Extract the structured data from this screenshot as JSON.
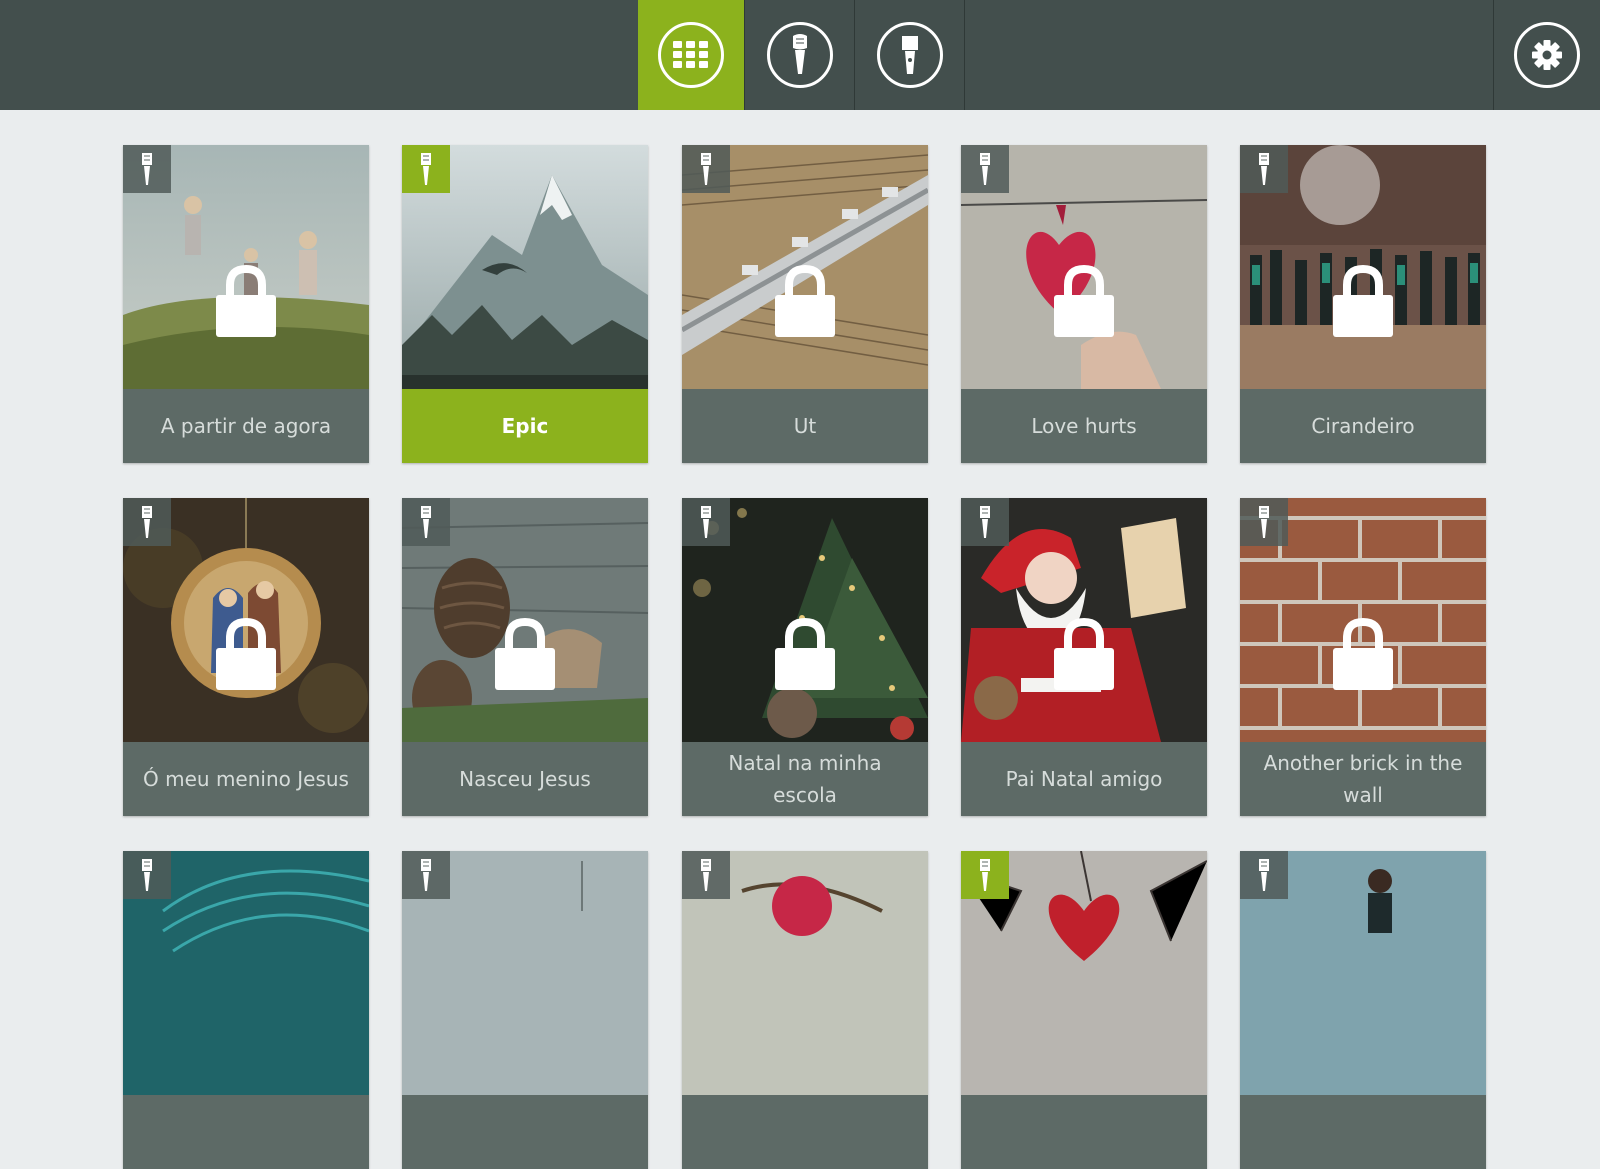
{
  "header": {
    "nav": [
      {
        "id": "grid",
        "icon": "grid-icon",
        "label": "",
        "active": true
      },
      {
        "id": "mic",
        "icon": "microphone-icon",
        "label": "",
        "active": false
      },
      {
        "id": "mic-alt",
        "icon": "microphone-alt-icon",
        "label": "",
        "active": false
      }
    ],
    "settings_icon": "gear-icon"
  },
  "songs": [
    {
      "title": "A partir de agora",
      "locked": true,
      "selected": false,
      "theme": "field"
    },
    {
      "title": "Epic",
      "locked": false,
      "selected": true,
      "theme": "mountain"
    },
    {
      "title": "Ut",
      "locked": true,
      "selected": false,
      "theme": "flute"
    },
    {
      "title": "Love hurts",
      "locked": true,
      "selected": false,
      "theme": "heart"
    },
    {
      "title": "Cirandeiro",
      "locked": true,
      "selected": false,
      "theme": "choir"
    },
    {
      "title": "Ó meu menino Jesus",
      "locked": true,
      "selected": false,
      "theme": "ornament"
    },
    {
      "title": "Nasceu Jesus",
      "locked": true,
      "selected": false,
      "theme": "pinecone"
    },
    {
      "title": "Natal na minha escola",
      "locked": true,
      "selected": false,
      "theme": "tree"
    },
    {
      "title": "Pai Natal amigo",
      "locked": true,
      "selected": false,
      "theme": "santa"
    },
    {
      "title": "Another brick in the wall",
      "locked": true,
      "selected": false,
      "theme": "brick"
    },
    {
      "title": "",
      "locked": false,
      "selected": false,
      "theme": "feather"
    },
    {
      "title": "",
      "locked": false,
      "selected": false,
      "theme": "sky"
    },
    {
      "title": "",
      "locked": false,
      "selected": false,
      "theme": "branch"
    },
    {
      "title": "",
      "locked": false,
      "selected": false,
      "theme": "crackedheart",
      "corner_active": true
    },
    {
      "title": "",
      "locked": false,
      "selected": false,
      "theme": "lake"
    }
  ],
  "colors": {
    "topbar": "#434f4d",
    "accent": "#8cb21d",
    "background": "#eaedee",
    "caption": "#5d6a66"
  }
}
